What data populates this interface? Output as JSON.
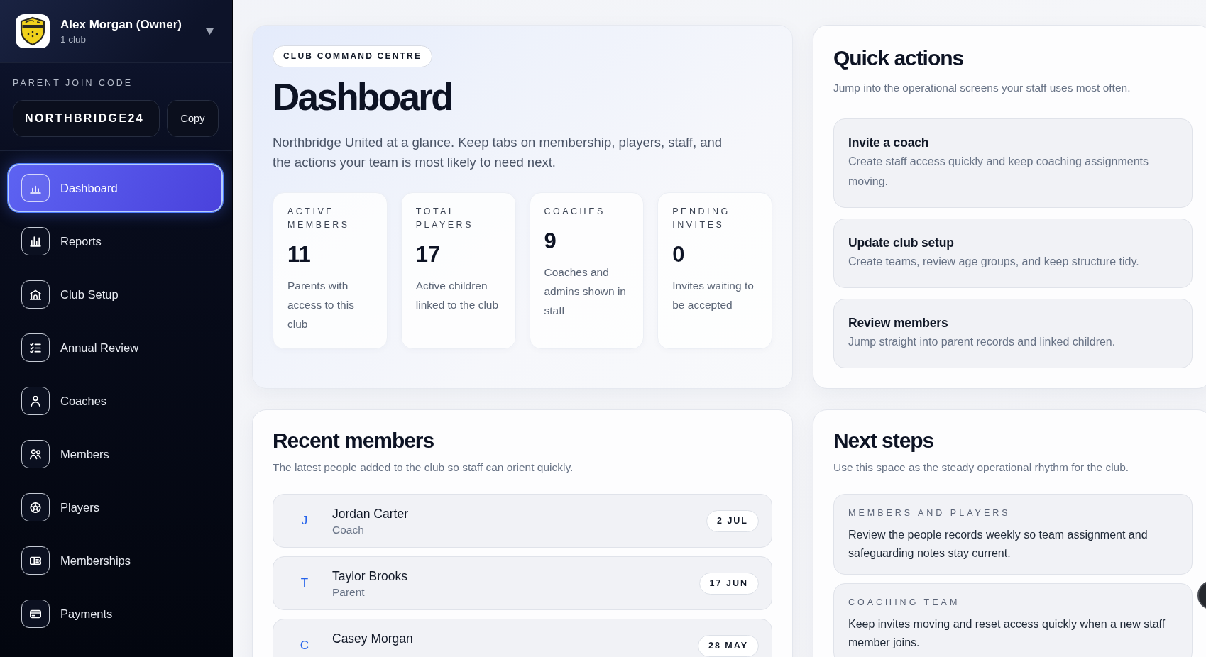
{
  "account": {
    "name": "Alex Morgan (Owner)",
    "subtitle": "1 club"
  },
  "join_code": {
    "label": "PARENT JOIN CODE",
    "code": "NORTHBRIDGE24",
    "button": "Copy"
  },
  "nav": [
    {
      "label": "Dashboard",
      "selected": true
    },
    {
      "label": "Reports",
      "selected": false
    },
    {
      "label": "Club Setup",
      "selected": false
    },
    {
      "label": "Annual Review",
      "selected": false
    },
    {
      "label": "Coaches",
      "selected": false
    },
    {
      "label": "Members",
      "selected": false
    },
    {
      "label": "Players",
      "selected": false
    },
    {
      "label": "Memberships",
      "selected": false
    },
    {
      "label": "Payments",
      "selected": false
    }
  ],
  "hero": {
    "eyebrow": "CLUB COMMAND CENTRE",
    "title": "Dashboard",
    "description": "Northbridge United at a glance. Keep tabs on membership, players, staff, and the actions your team is most likely to need next.",
    "stats": [
      {
        "label": "ACTIVE MEMBERS",
        "value": "11",
        "description": "Parents with access to this club"
      },
      {
        "label": "TOTAL PLAYERS",
        "value": "17",
        "description": "Active children linked to the club"
      },
      {
        "label": "COACHES",
        "value": "9",
        "description": "Coaches and admins shown in staff"
      },
      {
        "label": "PENDING INVITES",
        "value": "0",
        "description": "Invites waiting to be accepted"
      }
    ]
  },
  "quick_actions": {
    "title": "Quick actions",
    "subtitle": "Jump into the operational screens your staff uses most often.",
    "actions": [
      {
        "title": "Invite a coach",
        "description": "Create staff access quickly and keep coaching assignments moving."
      },
      {
        "title": "Update club setup",
        "description": "Create teams, review age groups, and keep structure tidy."
      },
      {
        "title": "Review members",
        "description": "Jump straight into parent records and linked children."
      }
    ]
  },
  "recent_members": {
    "title": "Recent members",
    "subtitle": "The latest people added to the club so staff can orient quickly.",
    "members": [
      {
        "initial": "J",
        "name": "Jordan Carter",
        "role": "Coach",
        "date": "2 JUL"
      },
      {
        "initial": "T",
        "name": "Taylor Brooks",
        "role": "Parent",
        "date": "17 JUN"
      },
      {
        "initial": "C",
        "name": "Casey Morgan",
        "date": "28 MAY"
      }
    ]
  },
  "next_steps": {
    "title": "Next steps",
    "subtitle": "Use this space as the steady operational rhythm for the club.",
    "steps": [
      {
        "label": "MEMBERS AND PLAYERS",
        "text": "Review the people records weekly so team assignment and safeguarding notes stay current."
      },
      {
        "label": "COACHING TEAM",
        "text": "Keep invites moving and reset access quickly when a new staff member joins."
      }
    ]
  }
}
